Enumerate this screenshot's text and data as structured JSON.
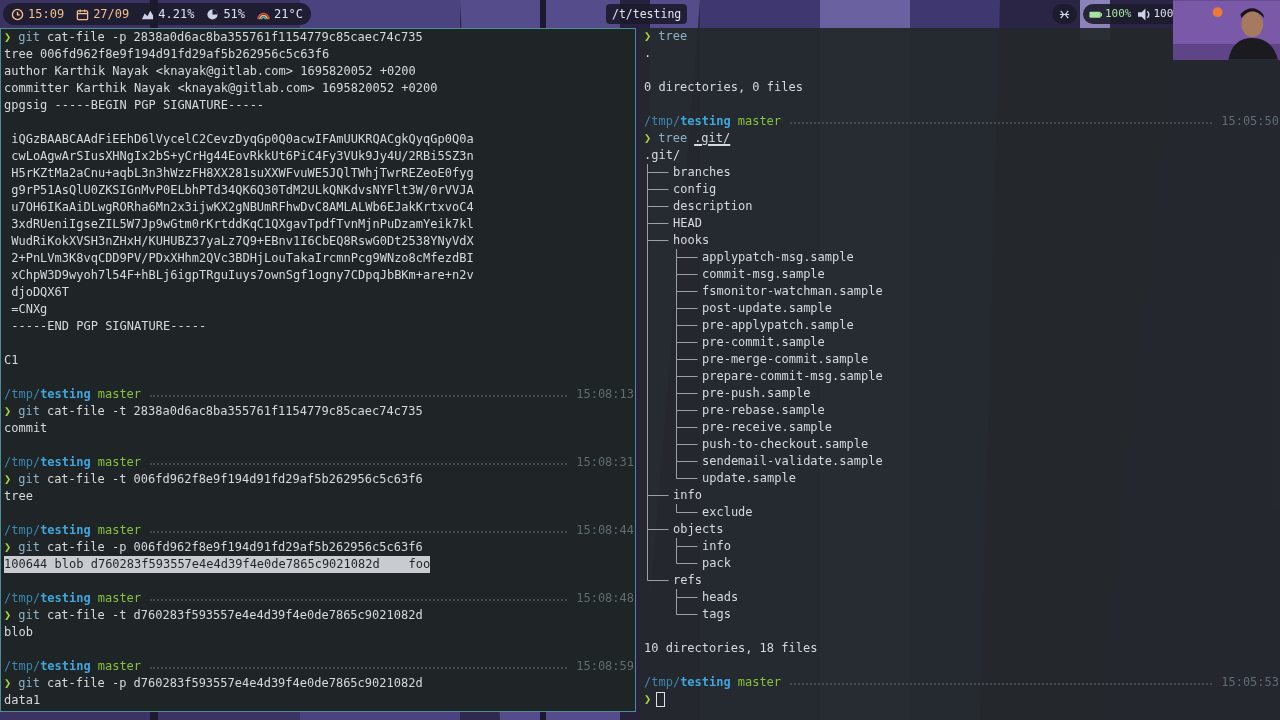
{
  "top_bar": {
    "left_widgets": [
      {
        "kind": "clock",
        "text": "15:09"
      },
      {
        "kind": "calendar",
        "text": "27/09"
      },
      {
        "kind": "cpu",
        "text": "4.21%"
      },
      {
        "kind": "memory",
        "text": "51%"
      },
      {
        "kind": "weather",
        "text": "21°C"
      }
    ],
    "workspace": "/t/testing",
    "right_widgets": [
      {
        "kind": "keyboard"
      },
      {
        "kind": "battery",
        "text": "100%"
      },
      {
        "kind": "volume",
        "text": "100"
      }
    ]
  },
  "left_terminal": {
    "lines": [
      {
        "kind": "command",
        "symbol": "❯",
        "program": "git",
        "args": "cat-file -p 2838a0d6ac8ba355761f1154779c85caec74c735",
        "underlined": false
      },
      {
        "kind": "output",
        "text": "tree 006fd962f8e9f194d91fd29af5b262956c5c63f6",
        "highlighted": false
      },
      {
        "kind": "output",
        "text": "author Karthik Nayak <knayak@gitlab.com> 1695820052 +0200",
        "highlighted": false
      },
      {
        "kind": "output",
        "text": "committer Karthik Nayak <knayak@gitlab.com> 1695820052 +0200",
        "highlighted": false
      },
      {
        "kind": "output",
        "text": "gpgsig -----BEGIN PGP SIGNATURE-----",
        "highlighted": false
      },
      {
        "kind": "blank"
      },
      {
        "kind": "output",
        "text": " iQGzBAABCAAdFiEEhD6lVycelC2CevzDyqGp0Q0acwIFAmUUKRQACgkQyqGp0Q0a",
        "highlighted": false
      },
      {
        "kind": "output",
        "text": " cwLoAgwArSIusXHNgIx2bS+yCrHg44EovRkkUt6PiC4Fy3VUk9Jy4U/2RBi5SZ3n",
        "highlighted": false
      },
      {
        "kind": "output",
        "text": " H5rKZtMa2aCnu+aqbL3n3hWzzFH8XX281suXXWFvuWE5JQlTWhjTwrREZeoE0fyg",
        "highlighted": false
      },
      {
        "kind": "output",
        "text": " g9rP51AsQlU0ZKSIGnMvP0ELbhPTd34QK6Q30TdM2ULkQNKdvsNYFlt3W/0rVVJA",
        "highlighted": false
      },
      {
        "kind": "output",
        "text": " u7OH6IKaAiDLwgRORha6Mn2x3ijwKX2gNBUmRFhwDvC8AMLALWb6EJakKrtxvoC4",
        "highlighted": false
      },
      {
        "kind": "output",
        "text": " 3xdRUeniIgseZIL5W7Jp9wGtm0rKrtddKqC1QXgavTpdfTvnMjnPuDzamYeik7kl",
        "highlighted": false
      },
      {
        "kind": "output",
        "text": " WudRiKokXVSH3nZHxH/KUHUBZ37yaLz7Q9+EBnv1I6CbEQ8RswG0Dt2538YNyVdX",
        "highlighted": false
      },
      {
        "kind": "output",
        "text": " 2+PnLVm3K8vqCDD9PV/PDxXHhm2QVc3BDHjLouTakaIrcmnPcg9WNzo8cMfezdBI",
        "highlighted": false
      },
      {
        "kind": "output",
        "text": " xChpW3D9wyoh7l54F+hBLj6igpTRguIuys7ownSgf1ogny7CDpqJbBKm+are+n2v",
        "highlighted": false
      },
      {
        "kind": "output",
        "text": " djoDQX6T",
        "highlighted": false
      },
      {
        "kind": "output",
        "text": " =CNXg",
        "highlighted": false
      },
      {
        "kind": "output",
        "text": " -----END PGP SIGNATURE-----",
        "highlighted": false
      },
      {
        "kind": "blank"
      },
      {
        "kind": "output",
        "text": "C1",
        "highlighted": false
      },
      {
        "kind": "blank"
      },
      {
        "kind": "prompt",
        "path": "/tmp/",
        "dir": "testing",
        "branch": "master",
        "time": "15:08:13"
      },
      {
        "kind": "command",
        "symbol": "❯",
        "program": "git",
        "args": "cat-file -t 2838a0d6ac8ba355761f1154779c85caec74c735",
        "underlined": false
      },
      {
        "kind": "output",
        "text": "commit",
        "highlighted": false
      },
      {
        "kind": "blank"
      },
      {
        "kind": "prompt",
        "path": "/tmp/",
        "dir": "testing",
        "branch": "master",
        "time": "15:08:31"
      },
      {
        "kind": "command",
        "symbol": "❯",
        "program": "git",
        "args": "cat-file -t 006fd962f8e9f194d91fd29af5b262956c5c63f6",
        "underlined": false
      },
      {
        "kind": "output",
        "text": "tree",
        "highlighted": false
      },
      {
        "kind": "blank"
      },
      {
        "kind": "prompt",
        "path": "/tmp/",
        "dir": "testing",
        "branch": "master",
        "time": "15:08:44"
      },
      {
        "kind": "command",
        "symbol": "❯",
        "program": "git",
        "args": "cat-file -p 006fd962f8e9f194d91fd29af5b262956c5c63f6",
        "underlined": false
      },
      {
        "kind": "output",
        "text": "100644 blob d760283f593557e4e4d39f4e0de7865c9021082d    foo",
        "highlighted": true
      },
      {
        "kind": "blank"
      },
      {
        "kind": "prompt",
        "path": "/tmp/",
        "dir": "testing",
        "branch": "master",
        "time": "15:08:48"
      },
      {
        "kind": "command",
        "symbol": "❯",
        "program": "git",
        "args": "cat-file -t d760283f593557e4e4d39f4e0de7865c9021082d",
        "underlined": false
      },
      {
        "kind": "output",
        "text": "blob",
        "highlighted": false
      },
      {
        "kind": "blank"
      },
      {
        "kind": "prompt",
        "path": "/tmp/",
        "dir": "testing",
        "branch": "master",
        "time": "15:08:59"
      },
      {
        "kind": "command",
        "symbol": "❯",
        "program": "git",
        "args": "cat-file -p d760283f593557e4e4d39f4e0de7865c9021082d",
        "underlined": false
      },
      {
        "kind": "output",
        "text": "data1",
        "highlighted": false
      }
    ]
  },
  "right_terminal": {
    "lines": [
      {
        "kind": "command",
        "symbol": "❯",
        "program": "tree"
      },
      {
        "kind": "output",
        "text": ".",
        "highlighted": false
      },
      {
        "kind": "blank"
      },
      {
        "kind": "output",
        "text": "0 directories, 0 files",
        "highlighted": false
      },
      {
        "kind": "blank"
      },
      {
        "kind": "prompt",
        "path": "/tmp/",
        "dir": "testing",
        "branch": "master",
        "time": "15:05:50"
      },
      {
        "kind": "command",
        "symbol": "❯",
        "program": "tree",
        "args": ".git/",
        "underlined": true
      },
      {
        "kind": "tree",
        "root": ".git/",
        "children": [
          {
            "name": "branches"
          },
          {
            "name": "config"
          },
          {
            "name": "description"
          },
          {
            "name": "HEAD"
          },
          {
            "name": "hooks",
            "children": [
              {
                "name": "applypatch-msg.sample"
              },
              {
                "name": "commit-msg.sample"
              },
              {
                "name": "fsmonitor-watchman.sample"
              },
              {
                "name": "post-update.sample"
              },
              {
                "name": "pre-applypatch.sample"
              },
              {
                "name": "pre-commit.sample"
              },
              {
                "name": "pre-merge-commit.sample"
              },
              {
                "name": "prepare-commit-msg.sample"
              },
              {
                "name": "pre-push.sample"
              },
              {
                "name": "pre-rebase.sample"
              },
              {
                "name": "pre-receive.sample"
              },
              {
                "name": "push-to-checkout.sample"
              },
              {
                "name": "sendemail-validate.sample"
              },
              {
                "name": "update.sample"
              }
            ]
          },
          {
            "name": "info",
            "children": [
              {
                "name": "exclude"
              }
            ]
          },
          {
            "name": "objects",
            "children": [
              {
                "name": "info"
              },
              {
                "name": "pack"
              }
            ]
          },
          {
            "name": "refs",
            "children": [
              {
                "name": "heads"
              },
              {
                "name": "tags"
              }
            ]
          }
        ]
      },
      {
        "kind": "blank"
      },
      {
        "kind": "output",
        "text": "10 directories, 18 files",
        "highlighted": false
      },
      {
        "kind": "blank"
      },
      {
        "kind": "prompt",
        "path": "/tmp/",
        "dir": "testing",
        "branch": "master",
        "time": "15:05:53"
      },
      {
        "kind": "input",
        "symbol": "❯",
        "cursor": true
      }
    ]
  }
}
